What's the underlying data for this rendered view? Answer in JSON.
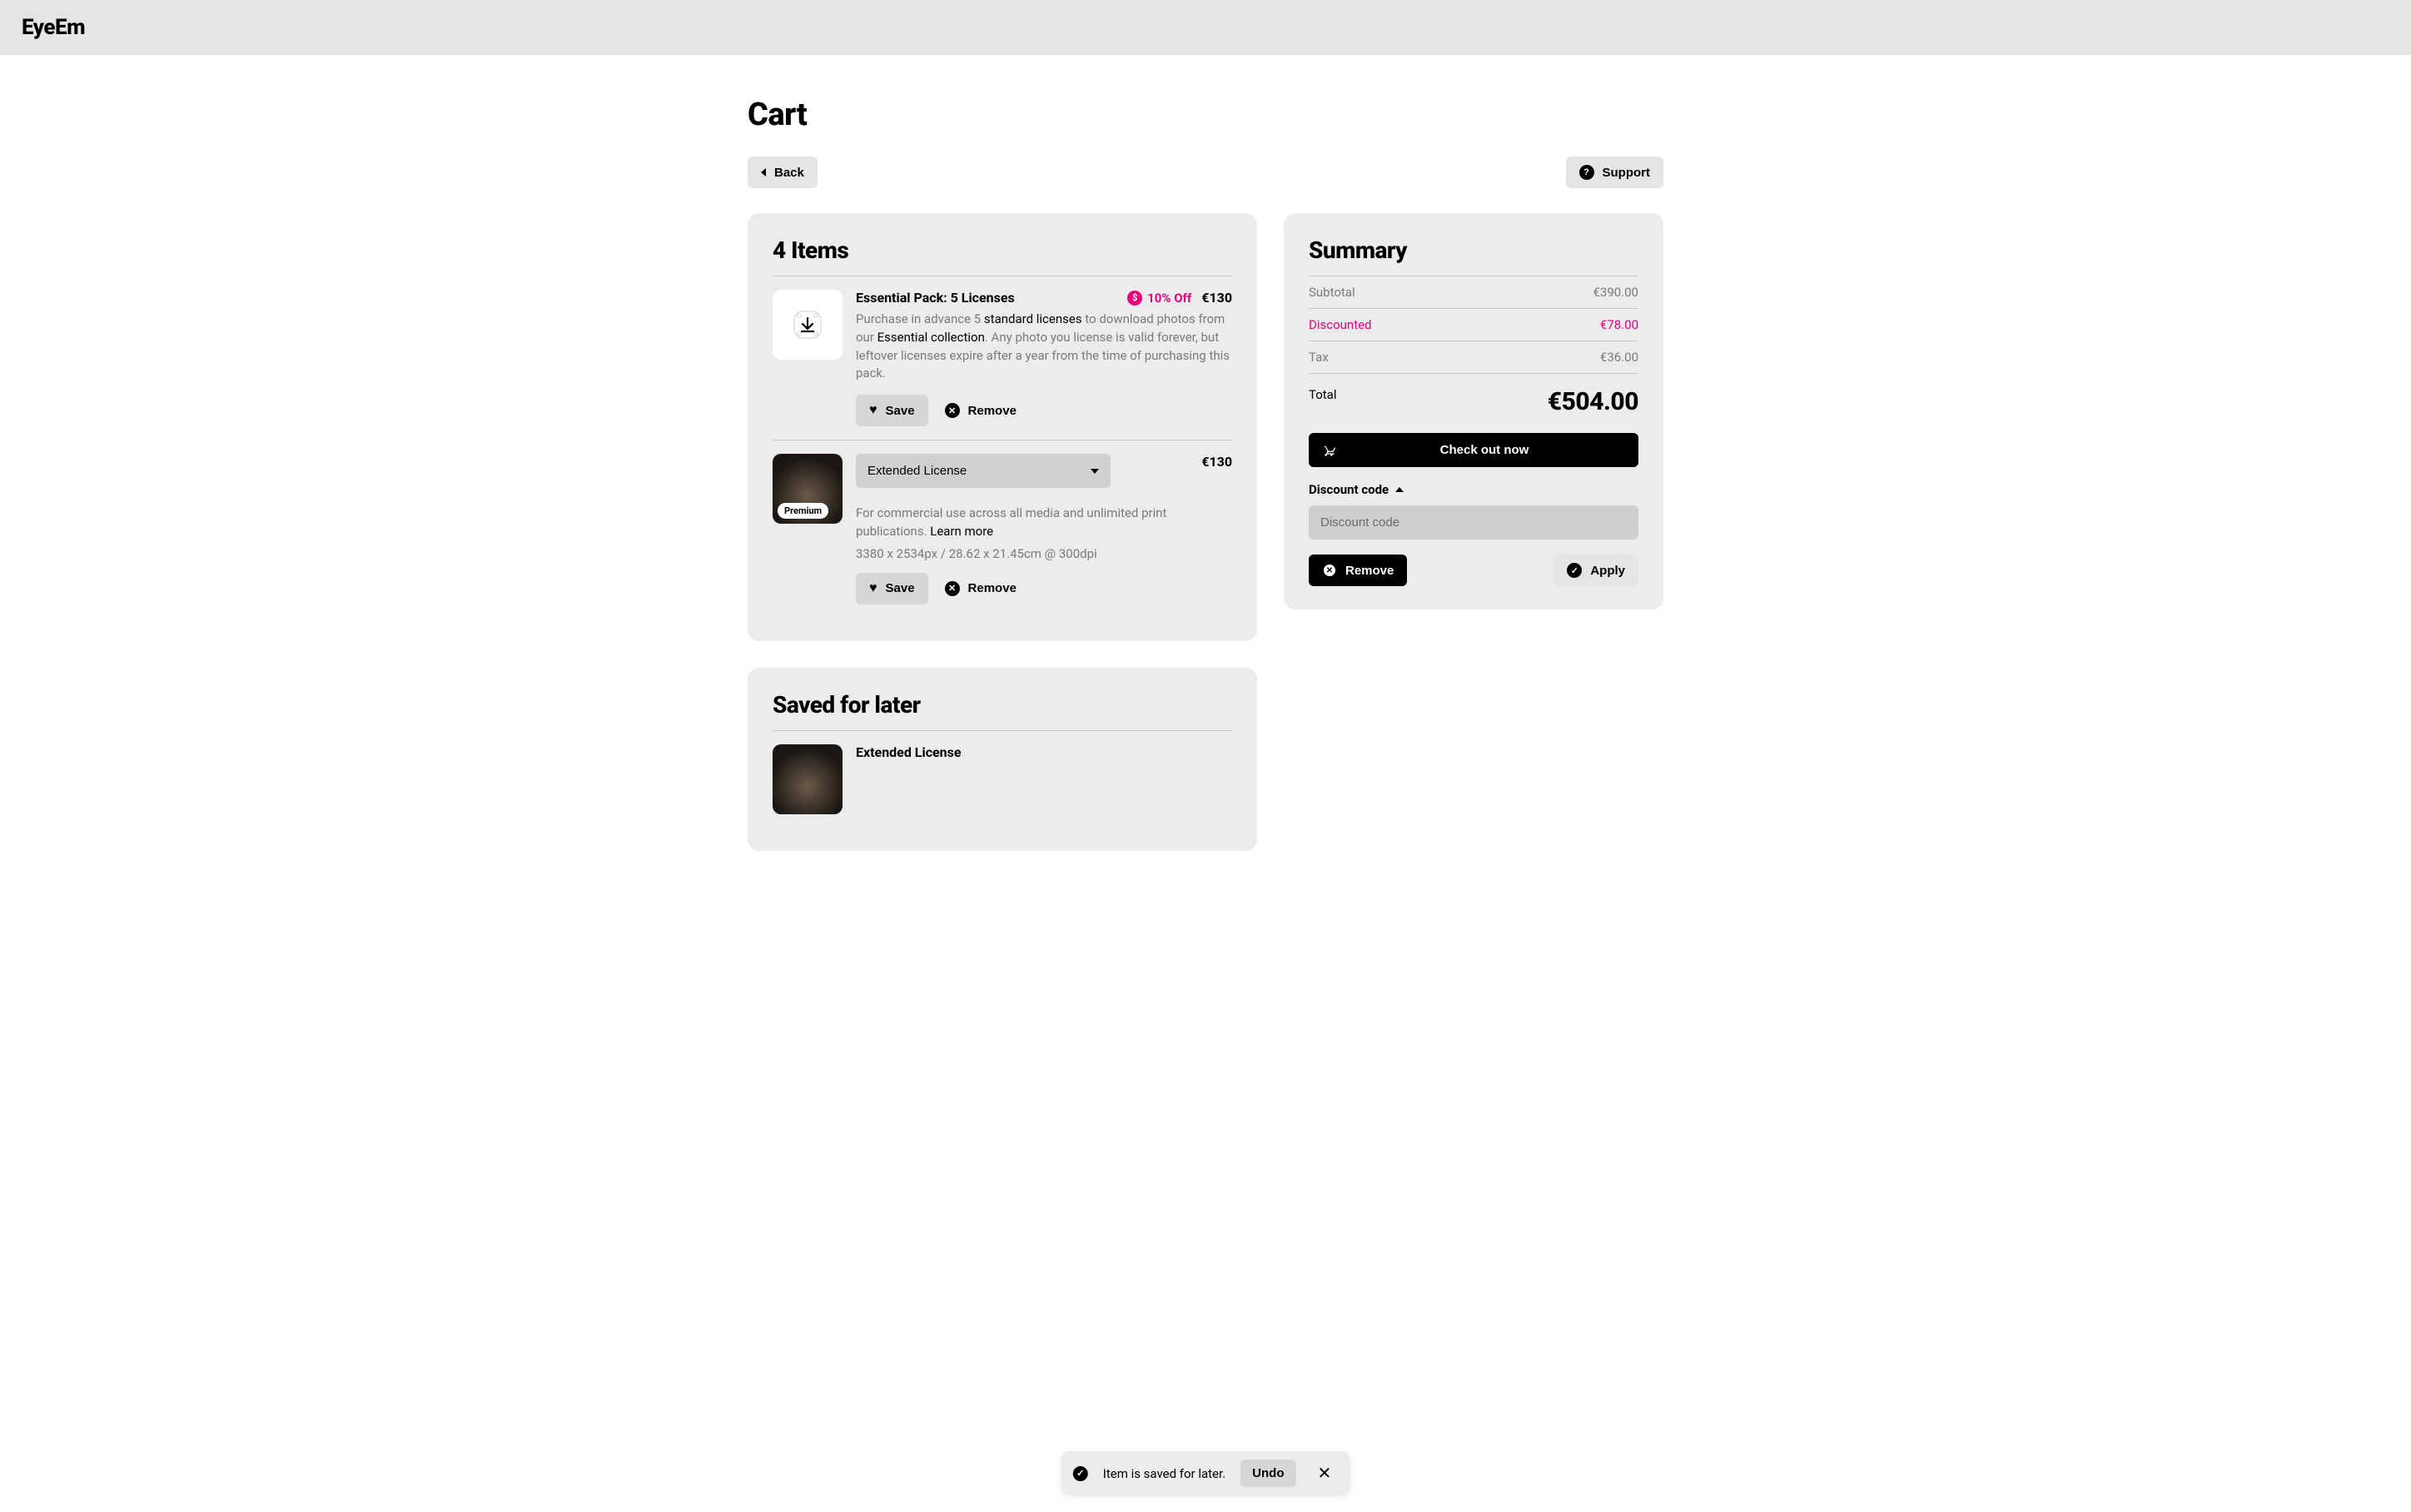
{
  "header": {
    "logo": "EyeEm"
  },
  "page_title": "Cart",
  "actions": {
    "back_label": "Back",
    "support_label": "Support"
  },
  "cart": {
    "title": "4 Items",
    "items": [
      {
        "title": "Essential Pack: 5 Licenses",
        "discount_label": "10% Off",
        "price": "€130",
        "desc_prefix": "Purchase in advance 5 ",
        "desc_bold1": "standard licenses",
        "desc_mid": " to download photos from our ",
        "desc_bold2": "Essential collection",
        "desc_suffix": ". Any photo you license is valid forever, but leftover licenses expire after a year from the time of purchasing this pack.",
        "save_label": "Save",
        "remove_label": "Remove"
      },
      {
        "license_label": "Extended License",
        "badge": "Premium",
        "price": "€130",
        "desc": "For commercial use across all media and unlimited print publications.",
        "learn_more": "Learn more",
        "dimensions": "3380 x 2534px / 28.62 x 21.45cm @ 300dpi",
        "save_label": "Save",
        "remove_label": "Remove"
      }
    ]
  },
  "saved": {
    "title": "Saved for later",
    "items": [
      {
        "title": "Extended License"
      }
    ]
  },
  "summary": {
    "title": "Summary",
    "subtotal_label": "Subtotal",
    "subtotal_value": "€390.00",
    "discounted_label": "Discounted",
    "discounted_value": "€78.00",
    "tax_label": "Tax",
    "tax_value": "€36.00",
    "total_label": "Total",
    "total_value": "€504.00",
    "checkout_label": "Check out now",
    "discount_code_label": "Discount code",
    "discount_placeholder": "Discount code",
    "remove_label": "Remove",
    "apply_label": "Apply"
  },
  "toast": {
    "message": "Item is saved for later.",
    "undo_label": "Undo"
  }
}
